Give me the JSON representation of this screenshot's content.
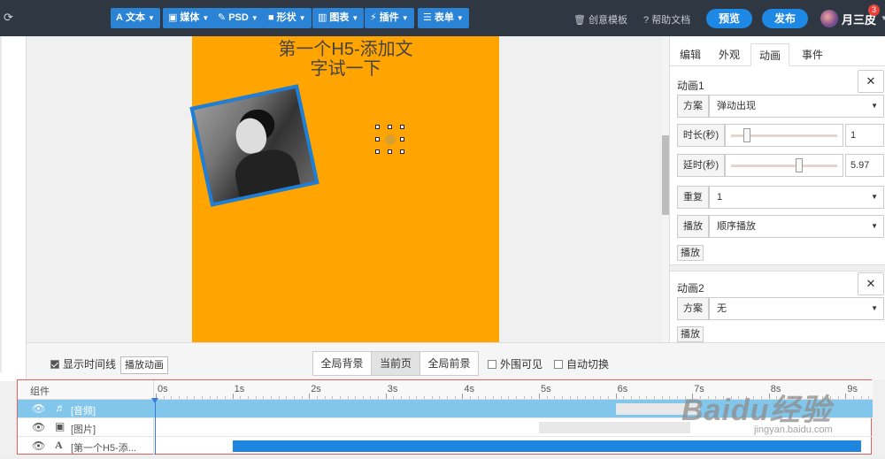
{
  "toolbar": {
    "buttons": [
      {
        "icon": "A",
        "label": "文本"
      },
      {
        "icon": "▣",
        "label": "媒体"
      },
      {
        "icon": "✎",
        "label": "PSD"
      },
      {
        "icon": "■",
        "label": "形状"
      },
      {
        "icon": "▥",
        "label": "图表"
      },
      {
        "icon": "⚡",
        "label": "插件"
      },
      {
        "icon": "☰",
        "label": "表单"
      }
    ],
    "creative_template": "创意模板",
    "help_docs": "帮助文档",
    "preview": "预览",
    "publish": "发布",
    "username": "月三皮",
    "notification_count": "3"
  },
  "canvas": {
    "title_line1": "第一个H5-添加文",
    "title_line2": "字试一下",
    "background_color": "#ffa400"
  },
  "panel": {
    "tabs": [
      "编辑",
      "外观",
      "动画",
      "事件"
    ],
    "active_tab": "动画",
    "anim1": {
      "title": "动画1",
      "scheme_label": "方案",
      "scheme_value": "弹动出现",
      "duration_label": "时长(秒)",
      "duration_value": "1",
      "duration_level": 0.15,
      "delay_label": "延时(秒)",
      "delay_value": "5.97",
      "delay_level": 0.64,
      "repeat_label": "重复",
      "repeat_value": "1",
      "play_label": "播放",
      "play_value": "顺序播放",
      "play_button": "播放"
    },
    "anim2": {
      "title": "动画2",
      "scheme_label": "方案",
      "scheme_value": "无",
      "play_button": "播放"
    }
  },
  "controls": {
    "show_timeline": "显示时间线",
    "play_animation": "播放动画",
    "segments": [
      "全局背景",
      "当前页",
      "全局前景"
    ],
    "active_segment": "当前页",
    "outside_visible": "外围可见",
    "auto_switch": "自动切换"
  },
  "timeline": {
    "header": "组件",
    "ticks": [
      "0s",
      "1s",
      "2s",
      "3s",
      "4s",
      "5s",
      "6s",
      "7s",
      "8s",
      "9s"
    ],
    "rows": [
      {
        "icon": "♬",
        "name": "[音频]",
        "start": 6.0,
        "end": 7.1,
        "color": "#e8e8e8",
        "selected": true
      },
      {
        "icon": "▣",
        "name": "[图片]",
        "start": 5.0,
        "end": 6.97,
        "color": "#e8e8e8",
        "selected": false
      },
      {
        "icon": "A",
        "name": "[第一个H5-添...",
        "start": 1.0,
        "end": 9.2,
        "color": "#1f86e0",
        "selected": false
      }
    ]
  },
  "watermark": {
    "main": "Baidu经验",
    "sub": "jingyan.baidu.com"
  }
}
